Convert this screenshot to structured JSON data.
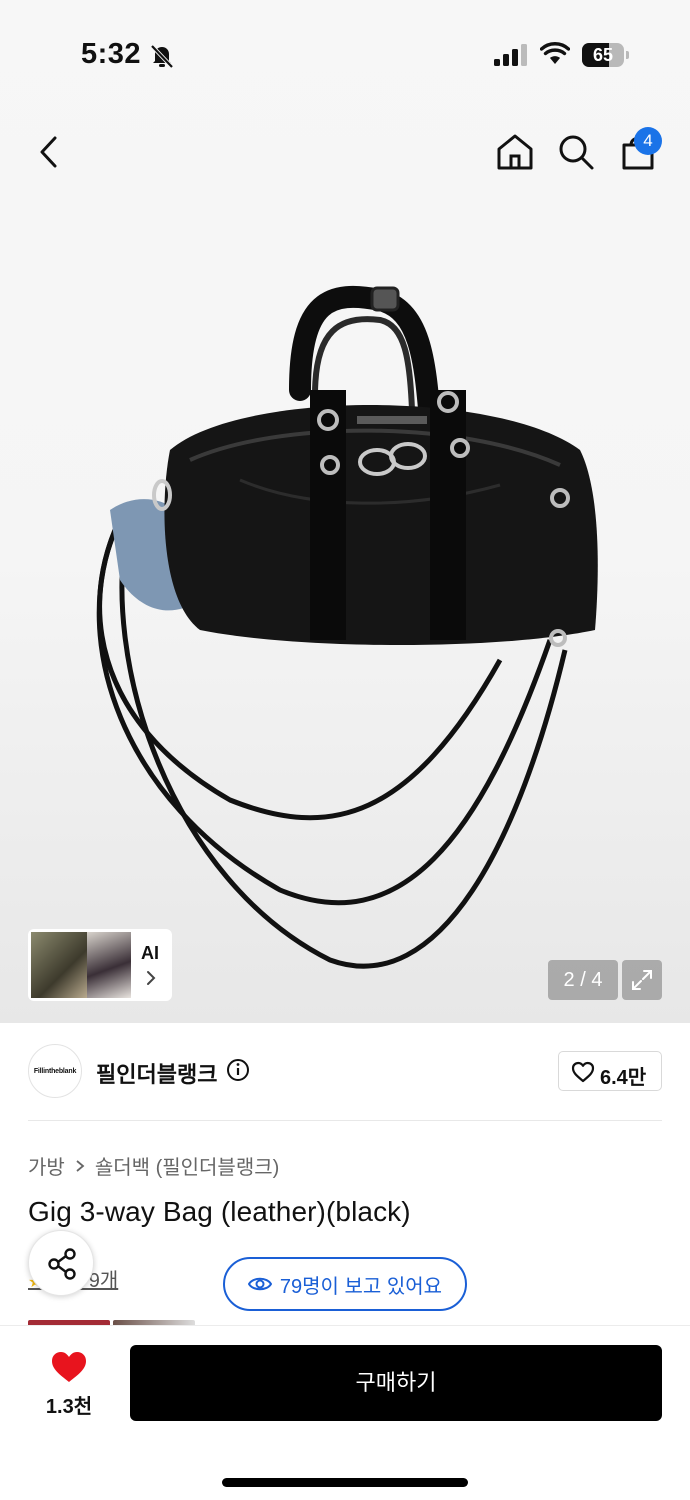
{
  "status_bar": {
    "time": "5:32",
    "battery": "65",
    "battery_level": 0.65
  },
  "header": {
    "cart_count": "4"
  },
  "gallery": {
    "ai_label": "AI",
    "page_counter": "2 / 4"
  },
  "brand": {
    "logo_text": "Fillintheblank",
    "name": "필인더블랭크",
    "like_count": "6.4만"
  },
  "product": {
    "breadcrumb": [
      "가방",
      "숄더백 (필인더블랭크)"
    ],
    "title": "Gig 3-way Bag (leather)(black)",
    "review_link": "후기 9개",
    "viewers": "79명이 보고 있어요"
  },
  "bottom_bar": {
    "like_count": "1.3천",
    "buy_label": "구매하기"
  },
  "colors": {
    "accent_blue": "#1a5fd6",
    "badge_blue": "#1a73e8",
    "like_red": "#e8141e",
    "buy_black": "#000000"
  },
  "icons": [
    "back-icon",
    "home-icon",
    "search-icon",
    "cart-icon",
    "chevron-right-icon",
    "expand-icon",
    "info-icon",
    "heart-outline-icon",
    "share-icon",
    "eye-icon",
    "heart-filled-icon"
  ]
}
